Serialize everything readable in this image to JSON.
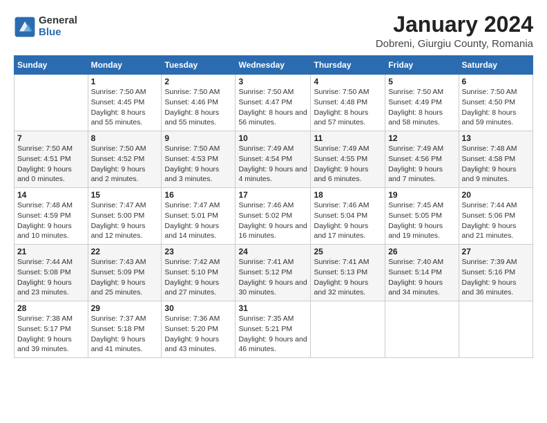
{
  "logo": {
    "general": "General",
    "blue": "Blue"
  },
  "title": "January 2024",
  "location": "Dobreni, Giurgiu County, Romania",
  "headers": [
    "Sunday",
    "Monday",
    "Tuesday",
    "Wednesday",
    "Thursday",
    "Friday",
    "Saturday"
  ],
  "weeks": [
    [
      {
        "day": "",
        "sunrise": "",
        "sunset": "",
        "daylight": ""
      },
      {
        "day": "1",
        "sunrise": "Sunrise: 7:50 AM",
        "sunset": "Sunset: 4:45 PM",
        "daylight": "Daylight: 8 hours and 55 minutes."
      },
      {
        "day": "2",
        "sunrise": "Sunrise: 7:50 AM",
        "sunset": "Sunset: 4:46 PM",
        "daylight": "Daylight: 8 hours and 55 minutes."
      },
      {
        "day": "3",
        "sunrise": "Sunrise: 7:50 AM",
        "sunset": "Sunset: 4:47 PM",
        "daylight": "Daylight: 8 hours and 56 minutes."
      },
      {
        "day": "4",
        "sunrise": "Sunrise: 7:50 AM",
        "sunset": "Sunset: 4:48 PM",
        "daylight": "Daylight: 8 hours and 57 minutes."
      },
      {
        "day": "5",
        "sunrise": "Sunrise: 7:50 AM",
        "sunset": "Sunset: 4:49 PM",
        "daylight": "Daylight: 8 hours and 58 minutes."
      },
      {
        "day": "6",
        "sunrise": "Sunrise: 7:50 AM",
        "sunset": "Sunset: 4:50 PM",
        "daylight": "Daylight: 8 hours and 59 minutes."
      }
    ],
    [
      {
        "day": "7",
        "sunrise": "Sunrise: 7:50 AM",
        "sunset": "Sunset: 4:51 PM",
        "daylight": "Daylight: 9 hours and 0 minutes."
      },
      {
        "day": "8",
        "sunrise": "Sunrise: 7:50 AM",
        "sunset": "Sunset: 4:52 PM",
        "daylight": "Daylight: 9 hours and 2 minutes."
      },
      {
        "day": "9",
        "sunrise": "Sunrise: 7:50 AM",
        "sunset": "Sunset: 4:53 PM",
        "daylight": "Daylight: 9 hours and 3 minutes."
      },
      {
        "day": "10",
        "sunrise": "Sunrise: 7:49 AM",
        "sunset": "Sunset: 4:54 PM",
        "daylight": "Daylight: 9 hours and 4 minutes."
      },
      {
        "day": "11",
        "sunrise": "Sunrise: 7:49 AM",
        "sunset": "Sunset: 4:55 PM",
        "daylight": "Daylight: 9 hours and 6 minutes."
      },
      {
        "day": "12",
        "sunrise": "Sunrise: 7:49 AM",
        "sunset": "Sunset: 4:56 PM",
        "daylight": "Daylight: 9 hours and 7 minutes."
      },
      {
        "day": "13",
        "sunrise": "Sunrise: 7:48 AM",
        "sunset": "Sunset: 4:58 PM",
        "daylight": "Daylight: 9 hours and 9 minutes."
      }
    ],
    [
      {
        "day": "14",
        "sunrise": "Sunrise: 7:48 AM",
        "sunset": "Sunset: 4:59 PM",
        "daylight": "Daylight: 9 hours and 10 minutes."
      },
      {
        "day": "15",
        "sunrise": "Sunrise: 7:47 AM",
        "sunset": "Sunset: 5:00 PM",
        "daylight": "Daylight: 9 hours and 12 minutes."
      },
      {
        "day": "16",
        "sunrise": "Sunrise: 7:47 AM",
        "sunset": "Sunset: 5:01 PM",
        "daylight": "Daylight: 9 hours and 14 minutes."
      },
      {
        "day": "17",
        "sunrise": "Sunrise: 7:46 AM",
        "sunset": "Sunset: 5:02 PM",
        "daylight": "Daylight: 9 hours and 16 minutes."
      },
      {
        "day": "18",
        "sunrise": "Sunrise: 7:46 AM",
        "sunset": "Sunset: 5:04 PM",
        "daylight": "Daylight: 9 hours and 17 minutes."
      },
      {
        "day": "19",
        "sunrise": "Sunrise: 7:45 AM",
        "sunset": "Sunset: 5:05 PM",
        "daylight": "Daylight: 9 hours and 19 minutes."
      },
      {
        "day": "20",
        "sunrise": "Sunrise: 7:44 AM",
        "sunset": "Sunset: 5:06 PM",
        "daylight": "Daylight: 9 hours and 21 minutes."
      }
    ],
    [
      {
        "day": "21",
        "sunrise": "Sunrise: 7:44 AM",
        "sunset": "Sunset: 5:08 PM",
        "daylight": "Daylight: 9 hours and 23 minutes."
      },
      {
        "day": "22",
        "sunrise": "Sunrise: 7:43 AM",
        "sunset": "Sunset: 5:09 PM",
        "daylight": "Daylight: 9 hours and 25 minutes."
      },
      {
        "day": "23",
        "sunrise": "Sunrise: 7:42 AM",
        "sunset": "Sunset: 5:10 PM",
        "daylight": "Daylight: 9 hours and 27 minutes."
      },
      {
        "day": "24",
        "sunrise": "Sunrise: 7:41 AM",
        "sunset": "Sunset: 5:12 PM",
        "daylight": "Daylight: 9 hours and 30 minutes."
      },
      {
        "day": "25",
        "sunrise": "Sunrise: 7:41 AM",
        "sunset": "Sunset: 5:13 PM",
        "daylight": "Daylight: 9 hours and 32 minutes."
      },
      {
        "day": "26",
        "sunrise": "Sunrise: 7:40 AM",
        "sunset": "Sunset: 5:14 PM",
        "daylight": "Daylight: 9 hours and 34 minutes."
      },
      {
        "day": "27",
        "sunrise": "Sunrise: 7:39 AM",
        "sunset": "Sunset: 5:16 PM",
        "daylight": "Daylight: 9 hours and 36 minutes."
      }
    ],
    [
      {
        "day": "28",
        "sunrise": "Sunrise: 7:38 AM",
        "sunset": "Sunset: 5:17 PM",
        "daylight": "Daylight: 9 hours and 39 minutes."
      },
      {
        "day": "29",
        "sunrise": "Sunrise: 7:37 AM",
        "sunset": "Sunset: 5:18 PM",
        "daylight": "Daylight: 9 hours and 41 minutes."
      },
      {
        "day": "30",
        "sunrise": "Sunrise: 7:36 AM",
        "sunset": "Sunset: 5:20 PM",
        "daylight": "Daylight: 9 hours and 43 minutes."
      },
      {
        "day": "31",
        "sunrise": "Sunrise: 7:35 AM",
        "sunset": "Sunset: 5:21 PM",
        "daylight": "Daylight: 9 hours and 46 minutes."
      },
      {
        "day": "",
        "sunrise": "",
        "sunset": "",
        "daylight": ""
      },
      {
        "day": "",
        "sunrise": "",
        "sunset": "",
        "daylight": ""
      },
      {
        "day": "",
        "sunrise": "",
        "sunset": "",
        "daylight": ""
      }
    ]
  ]
}
